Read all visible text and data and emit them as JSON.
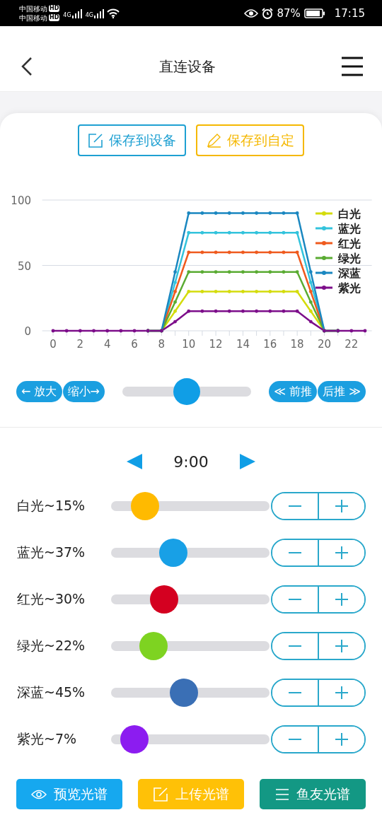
{
  "status_bar": {
    "carriers": [
      {
        "name": "中国移动",
        "badge": "HD",
        "network": "4G"
      },
      {
        "name": "中国移动",
        "badge": "HD",
        "network": "4G"
      }
    ],
    "battery": "87%",
    "time": "17:15"
  },
  "header": {
    "title": "直连设备"
  },
  "save_buttons": [
    {
      "label": "保存到设备",
      "color": "#1ea0d2"
    },
    {
      "label": "保存到自定",
      "color": "#f5b800"
    }
  ],
  "chart": {
    "chart_data": {
      "type": "line",
      "x": [
        0,
        1,
        2,
        3,
        4,
        5,
        6,
        7,
        8,
        9,
        10,
        11,
        12,
        13,
        14,
        15,
        16,
        17,
        18,
        19,
        20,
        21,
        22,
        23
      ],
      "xlim": [
        -0.8,
        23.5
      ],
      "legend": true,
      "ylim": [
        0,
        100
      ],
      "xticks": [
        0,
        2,
        4,
        6,
        8,
        10,
        12,
        14,
        16,
        18,
        20,
        22
      ],
      "yticks": [
        0,
        50,
        100
      ],
      "series": [
        {
          "name": "白光",
          "color": "#d4dc0c",
          "values": [
            null,
            null,
            null,
            null,
            null,
            null,
            null,
            0,
            0,
            15,
            30,
            30,
            30,
            30,
            30,
            30,
            30,
            30,
            30,
            15,
            0,
            0,
            null,
            null
          ]
        },
        {
          "name": "蓝光",
          "color": "#33c3dc",
          "values": [
            null,
            null,
            null,
            null,
            null,
            null,
            null,
            0,
            0,
            37,
            75,
            75,
            75,
            75,
            75,
            75,
            75,
            75,
            75,
            37,
            0,
            0,
            null,
            null
          ]
        },
        {
          "name": "红光",
          "color": "#ef5a1e",
          "values": [
            null,
            null,
            null,
            null,
            null,
            null,
            null,
            0,
            0,
            30,
            60,
            60,
            60,
            60,
            60,
            60,
            60,
            60,
            60,
            30,
            0,
            0,
            null,
            null
          ]
        },
        {
          "name": "绿光",
          "color": "#5aab32",
          "values": [
            null,
            null,
            null,
            null,
            null,
            null,
            null,
            0,
            0,
            22,
            45,
            45,
            45,
            45,
            45,
            45,
            45,
            45,
            45,
            22,
            0,
            0,
            null,
            null
          ]
        },
        {
          "name": "深蓝",
          "color": "#1a87c0",
          "values": [
            null,
            null,
            null,
            null,
            null,
            null,
            null,
            0,
            0,
            45,
            90,
            90,
            90,
            90,
            90,
            90,
            90,
            90,
            90,
            45,
            0,
            0,
            null,
            null
          ]
        },
        {
          "name": "紫光",
          "color": "#7d0e8a",
          "values": [
            0,
            0,
            0,
            0,
            0,
            0,
            0,
            0,
            0,
            7,
            15,
            15,
            15,
            15,
            15,
            15,
            15,
            15,
            15,
            7,
            0,
            0,
            0,
            0
          ]
        }
      ]
    }
  },
  "chart_controls": {
    "buttons": [
      "← 放大",
      "缩小→",
      "≪ 前推",
      "后推 ≫"
    ],
    "level": 0.5
  },
  "time": "9:00",
  "channels": [
    {
      "label": "白光~15%",
      "level": 0.15,
      "color": "#ffba00"
    },
    {
      "label": "蓝光~37%",
      "level": 0.37,
      "color": "#18a0e6"
    },
    {
      "label": "红光~30%",
      "level": 0.3,
      "color": "#d40020"
    },
    {
      "label": "绿光~22%",
      "level": 0.22,
      "color": "#7ed321"
    },
    {
      "label": "深蓝~45%",
      "level": 0.45,
      "color": "#3a6fb5"
    },
    {
      "label": "紫光~7%",
      "level": 0.07,
      "color": "#8c1cf0"
    }
  ],
  "actions": [
    {
      "label": "预览光谱",
      "kind": "eye",
      "color": "#16a8ef"
    },
    {
      "label": "上传光谱",
      "kind": "edit",
      "color": "#ffc107"
    },
    {
      "label": "鱼友光谱",
      "kind": "list",
      "color": "#139884"
    }
  ]
}
